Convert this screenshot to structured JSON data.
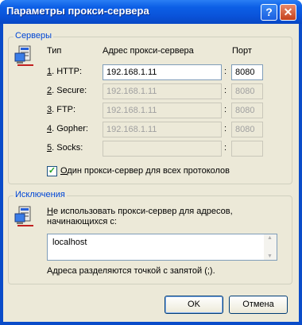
{
  "window": {
    "title": "Параметры прокси-сервера"
  },
  "servers": {
    "group_label": "Серверы",
    "headers": {
      "type": "Тип",
      "address": "Адрес прокси-сервера",
      "port": "Порт"
    },
    "rows": [
      {
        "key": "1",
        "label": ". HTTP:",
        "address": "192.168.1.11",
        "port": "8080",
        "enabled": true
      },
      {
        "key": "2",
        "label": ". Secure:",
        "address": "192.168.1.11",
        "port": "8080",
        "enabled": false
      },
      {
        "key": "3",
        "label": ". FTP:",
        "address": "192.168.1.11",
        "port": "8080",
        "enabled": false
      },
      {
        "key": "4",
        "label": ". Gopher:",
        "address": "192.168.1.11",
        "port": "8080",
        "enabled": false
      },
      {
        "key": "5",
        "label": ". Socks:",
        "address": "",
        "port": "",
        "enabled": false
      }
    ],
    "same_proxy": {
      "label_key": "О",
      "label": "дин прокси-сервер для всех протоколов",
      "checked": true
    }
  },
  "exceptions": {
    "group_label": "Исключения",
    "desc_key": "Н",
    "desc_line1": "е использовать прокси-сервер для адресов,",
    "desc_line2": "начинающихся с:",
    "value": "localhost",
    "hint": "Адреса разделяются точкой с запятой (;)."
  },
  "buttons": {
    "ok": "OK",
    "cancel": "Отмена"
  },
  "colors": {
    "title_bar": "#0a52d8",
    "group_label": "#0046d5",
    "dialog_bg": "#ece9d8"
  }
}
